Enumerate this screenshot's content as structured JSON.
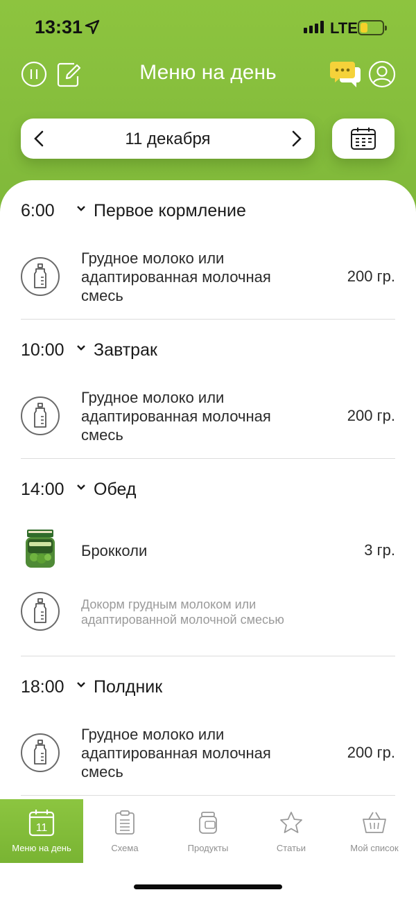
{
  "status": {
    "time": "13:31",
    "network": "LTE"
  },
  "header": {
    "title": "Меню на день"
  },
  "date_nav": {
    "date": "11 декабря"
  },
  "meals": [
    {
      "time": "6:00",
      "name": "Первое кормление",
      "items": [
        {
          "name": "Грудное молоко или адаптированная молочная смесь",
          "qty": "200 гр.",
          "icon": "bottle-icon"
        }
      ]
    },
    {
      "time": "10:00",
      "name": "Завтрак",
      "items": [
        {
          "name": "Грудное молоко или адаптированная молочная смесь",
          "qty": "200 гр.",
          "icon": "bottle-icon"
        }
      ]
    },
    {
      "time": "14:00",
      "name": "Обед",
      "items": [
        {
          "name": "Брокколи",
          "qty": "3 гр.",
          "icon": "baby-food-jar-image"
        },
        {
          "name": "Докорм грудным молоком или адаптированной молочной смесью",
          "qty": "",
          "icon": "bottle-icon"
        }
      ]
    },
    {
      "time": "18:00",
      "name": "Полдник",
      "items": [
        {
          "name": "Грудное молоко или адаптированная молочная смесь",
          "qty": "200 гр.",
          "icon": "bottle-icon"
        }
      ]
    }
  ],
  "tabbar": {
    "items": [
      {
        "label": "Меню на день",
        "icon": "calendar-day-icon",
        "icon_text": "11",
        "active": true
      },
      {
        "label": "Схема",
        "icon": "clipboard-icon",
        "active": false
      },
      {
        "label": "Продукты",
        "icon": "jar-icon",
        "active": false
      },
      {
        "label": "Статьи",
        "icon": "star-icon",
        "active": false
      },
      {
        "label": "Мой список",
        "icon": "basket-icon",
        "active": false
      }
    ]
  },
  "colors": {
    "accent": "#8dc43f",
    "chat_icon": "#f5d23a"
  }
}
